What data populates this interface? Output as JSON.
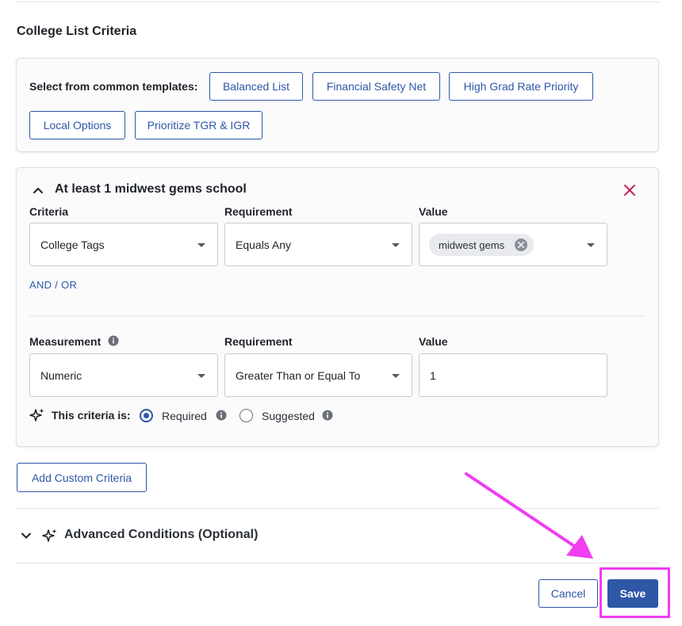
{
  "section_title": "College List Criteria",
  "templates": {
    "label": "Select from common templates:",
    "buttons": [
      "Balanced List",
      "Financial Safety Net",
      "High Grad Rate Priority",
      "Local Options",
      "Prioritize TGR & IGR"
    ]
  },
  "criteria_group": {
    "heading": "At least 1 midwest gems school",
    "row1": {
      "criteria_label": "Criteria",
      "criteria_value": "College Tags",
      "requirement_label": "Requirement",
      "requirement_value": "Equals Any",
      "value_label": "Value",
      "chip": "midwest gems"
    },
    "and_or": "AND  /  OR",
    "row2": {
      "measurement_label": "Measurement",
      "measurement_value": "Numeric",
      "requirement_label": "Requirement",
      "requirement_value": "Greater Than or Equal To",
      "value_label": "Value",
      "value": "1"
    },
    "criteria_is_label": "This criteria is:",
    "required_label": "Required",
    "suggested_label": "Suggested"
  },
  "add_custom_label": "Add Custom Criteria",
  "advanced_title": "Advanced Conditions (Optional)",
  "footer": {
    "cancel_label": "Cancel",
    "save_label": "Save"
  },
  "colors": {
    "accent": "#2e57a6",
    "annotation": "#f03ef0",
    "remove": "#c0245c"
  }
}
